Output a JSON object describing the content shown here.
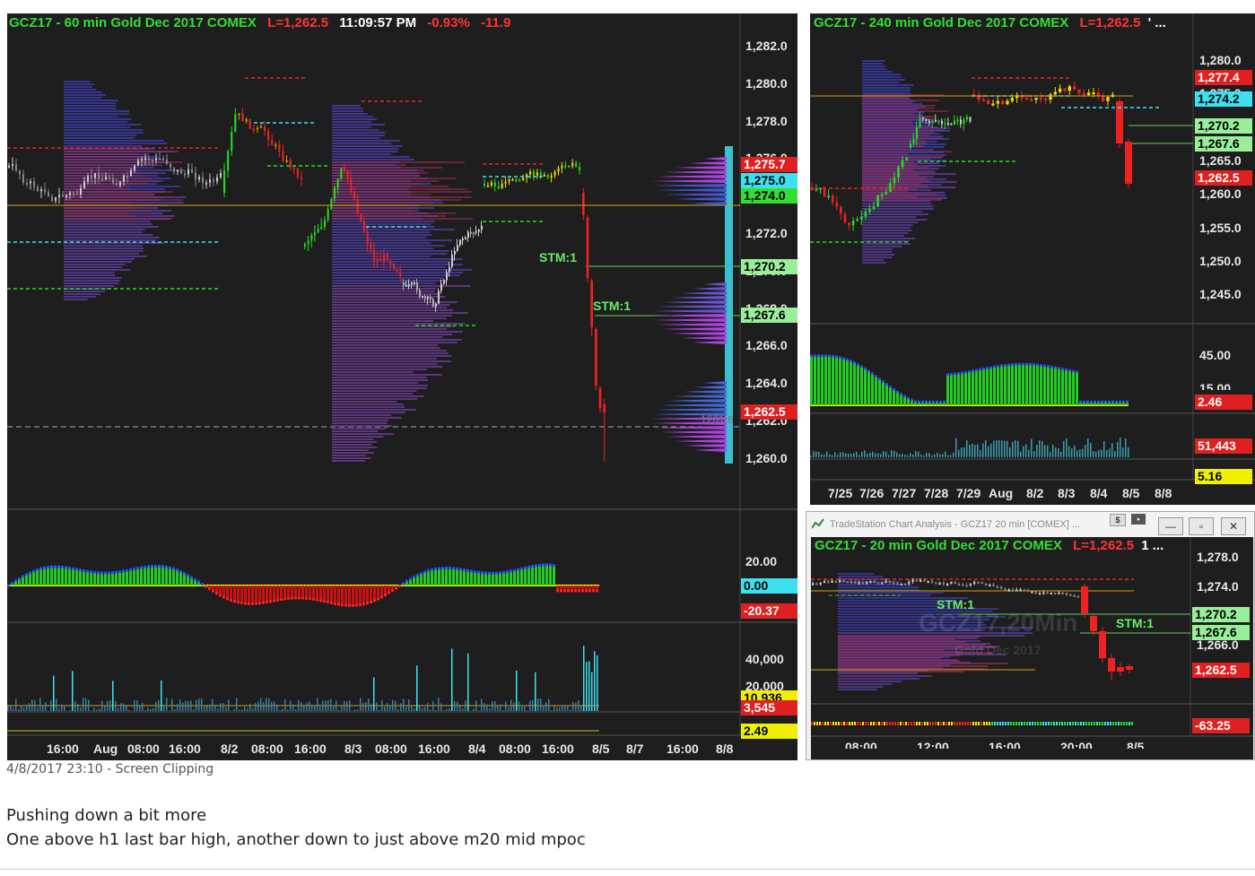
{
  "left_chart": {
    "header": {
      "symbol": "GCZ17 - 60 min  Gold Dec 2017  COMEX",
      "last": "L=1,262.5",
      "time": "11:09:57 PM",
      "pct": "-0.93%",
      "chg": "-11.9"
    },
    "price_axis": [
      "1,282.0",
      "1,280.0",
      "1,278.0",
      "1,276.0",
      "1,274.0",
      "1,272.0",
      "1,270.0",
      "1,268.0",
      "1,266.0",
      "1,264.0",
      "1,262.0",
      "1,260.0"
    ],
    "price_tags": [
      {
        "text": "1,275.7",
        "bg": "#e02020",
        "fg": "#ffffff"
      },
      {
        "text": "1,275.0",
        "bg": "#3de0f0",
        "fg": "#000000"
      },
      {
        "text": "1,274.0",
        "bg": "#33dd33",
        "fg": "#000000"
      },
      {
        "text": "1,270.2",
        "bg": "#99ee99",
        "fg": "#000000"
      },
      {
        "text": "1,267.6",
        "bg": "#99ee99",
        "fg": "#000000"
      },
      {
        "text": "1,262.5",
        "bg": "#e02020",
        "fg": "#ffffff"
      }
    ],
    "stm_labels": [
      "STM:1",
      "STM:1"
    ],
    "profile_label": "1261.6",
    "osc_axis": [
      "20.00"
    ],
    "osc_tags": [
      {
        "text": "0.00",
        "bg": "#3de0f0",
        "fg": "#000000"
      },
      {
        "text": "-20.37",
        "bg": "#e02020",
        "fg": "#ffffff"
      }
    ],
    "vol_axis": [
      "40,000",
      "20,000"
    ],
    "vol_tags": [
      {
        "text": "10,936",
        "bg": "#f0f000",
        "fg": "#000000"
      },
      {
        "text": "3,545",
        "bg": "#e02020",
        "fg": "#ffffff"
      }
    ],
    "extra_tag": {
      "text": "2.49",
      "bg": "#f0f000",
      "fg": "#000000"
    },
    "time_axis": [
      "16:00",
      "Aug",
      "08:00",
      "16:00",
      "8/2",
      "08:00",
      "16:00",
      "8/3",
      "08:00",
      "16:00",
      "8/4",
      "08:00",
      "16:00",
      "8/5",
      "8/7",
      "16:00",
      "8/8"
    ]
  },
  "right_top_chart": {
    "header": {
      "symbol": "GCZ17 - 240 min  Gold Dec 2017  COMEX",
      "last": "L=1,262.5",
      "more": "' ..."
    },
    "price_axis": [
      "1,280.0",
      "1,275.0",
      "1,270.0",
      "1,265.0",
      "1,260.0",
      "1,255.0",
      "1,250.0",
      "1,245.0"
    ],
    "price_tags": [
      {
        "text": "1,277.4",
        "bg": "#e02020",
        "fg": "#ffffff"
      },
      {
        "text": "1,274.2",
        "bg": "#3de0f0",
        "fg": "#000000"
      },
      {
        "text": "1,270.2",
        "bg": "#99ee99",
        "fg": "#000000"
      },
      {
        "text": "1,267.6",
        "bg": "#99ee99",
        "fg": "#000000"
      },
      {
        "text": "1,262.5",
        "bg": "#e02020",
        "fg": "#ffffff"
      }
    ],
    "osc_axis": [
      "45.00",
      "15.00"
    ],
    "osc_tags": [
      {
        "text": "2.46",
        "bg": "#e02020",
        "fg": "#ffffff"
      }
    ],
    "vol_tags": [
      {
        "text": "51,443",
        "bg": "#e02020",
        "fg": "#ffffff"
      },
      {
        "text": "5.16",
        "bg": "#f0f000",
        "fg": "#000000"
      }
    ],
    "time_axis": [
      "7/25",
      "7/26",
      "7/27",
      "7/28",
      "7/29",
      "Aug",
      "8/2",
      "8/3",
      "8/4",
      "8/5",
      "8/8"
    ]
  },
  "right_bottom_window": {
    "titlebar": "TradeStation Chart Analysis - GCZ17 20 min [COMEX] ...",
    "header": {
      "symbol": "GCZ17 - 20 min  Gold Dec 2017  COMEX",
      "last": "L=1,262.5",
      "more": "1 ..."
    },
    "price_axis": [
      "1,278.0",
      "1,274.0",
      "1,270.0",
      "1,266.0"
    ],
    "price_tags": [
      {
        "text": "1,270.2",
        "bg": "#99ee99",
        "fg": "#000000"
      },
      {
        "text": "1,267.6",
        "bg": "#99ee99",
        "fg": "#000000"
      },
      {
        "text": "1,262.5",
        "bg": "#e02020",
        "fg": "#ffffff"
      }
    ],
    "stm_labels": [
      "STM:1",
      "STM:1"
    ],
    "watermark": [
      "GCZ17,20Min",
      "Gold Dec 2017"
    ],
    "osc_tags": [
      {
        "text": "-63.25",
        "bg": "#e02020",
        "fg": "#ffffff"
      }
    ],
    "time_axis": [
      "08:00",
      "12:00",
      "16:00",
      "20:00",
      "8/5"
    ]
  },
  "caption": {
    "clip": "4/8/2017 23:10 - Screen Clipping",
    "line1": "Pushing down a bit more",
    "line2": "One above h1 last bar high, another down to just above m20 mid mpoc"
  },
  "colors": {
    "bg": "#1e1e1e",
    "up": "#22cc22",
    "down": "#ee2222",
    "header_green": "#33dd33",
    "header_red": "#ff3333",
    "cyan": "#3de0f0",
    "yellow": "#f0f000"
  }
}
